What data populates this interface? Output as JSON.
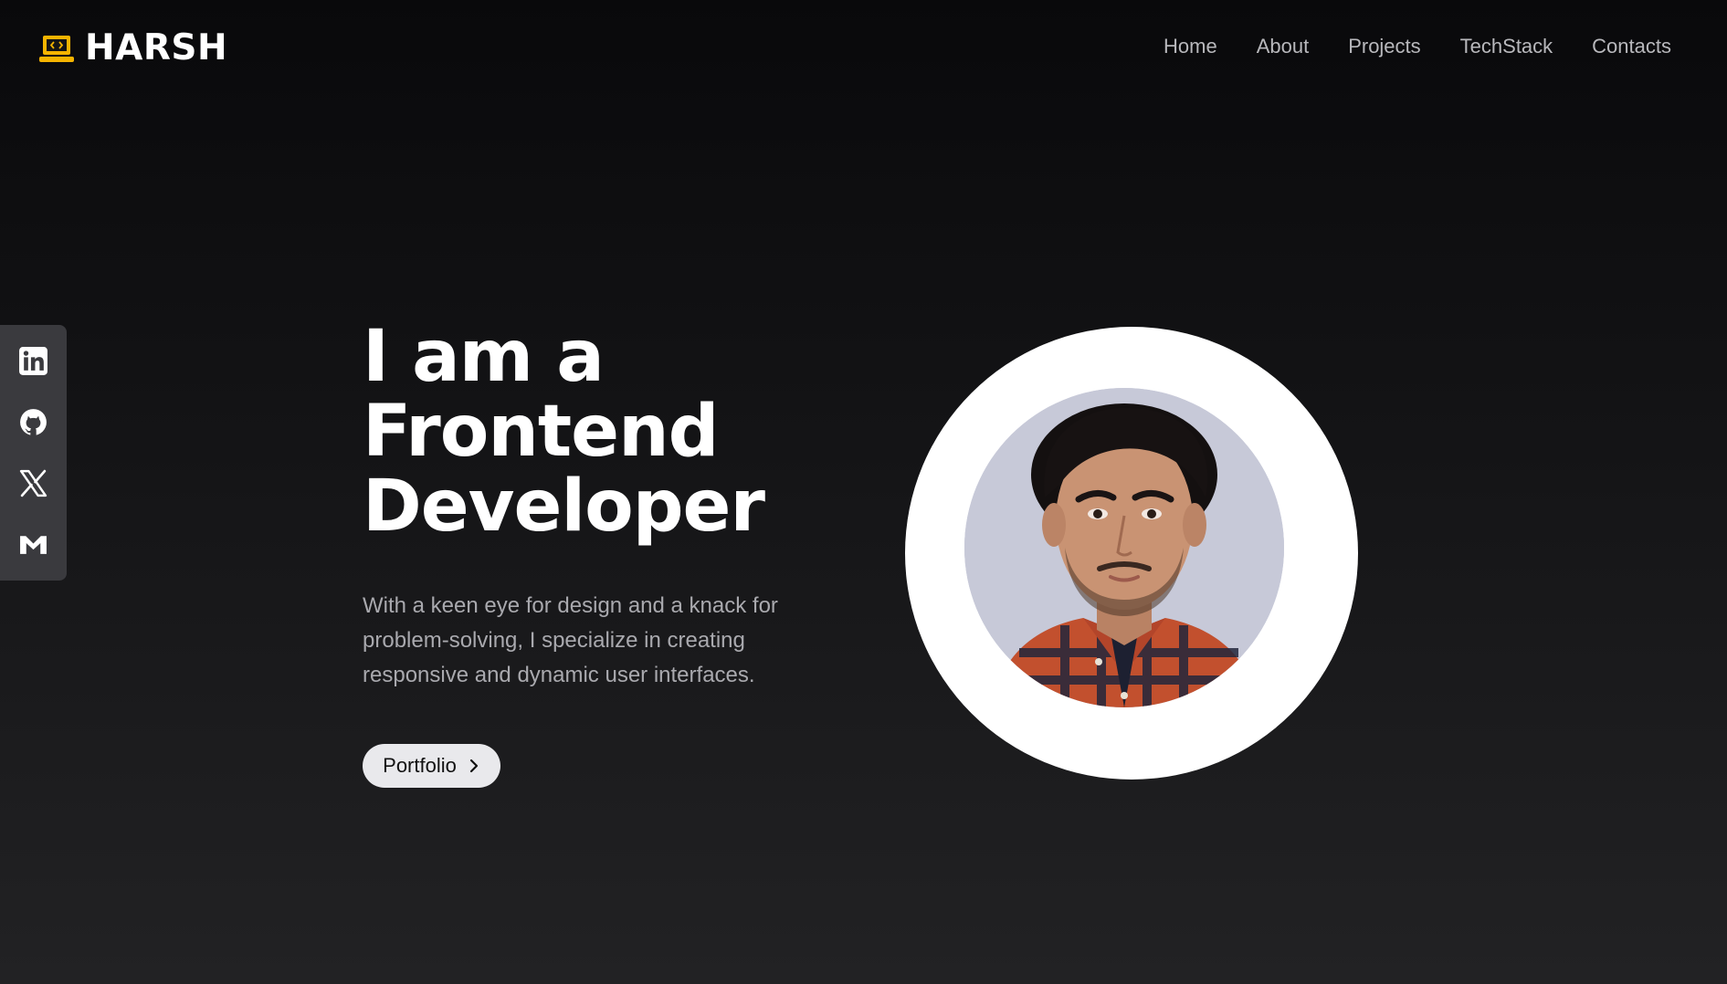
{
  "brand": {
    "name": "HARSH",
    "icon": "laptop-code-icon",
    "accent_color": "#f5b400"
  },
  "nav": {
    "items": [
      {
        "label": "Home"
      },
      {
        "label": "About"
      },
      {
        "label": "Projects"
      },
      {
        "label": "TechStack"
      },
      {
        "label": "Contacts"
      }
    ]
  },
  "social": {
    "items": [
      {
        "icon": "linkedin-icon"
      },
      {
        "icon": "github-icon"
      },
      {
        "icon": "x-twitter-icon"
      },
      {
        "icon": "gmail-icon"
      }
    ]
  },
  "hero": {
    "title_lines": [
      "I am a",
      "Frontend",
      "Developer"
    ],
    "description": "With a keen eye for design and a knack for problem-solving, I specialize in creating responsive and dynamic user interfaces.",
    "cta_label": "Portfolio",
    "cta_icon": "chevron-right-icon"
  },
  "avatar": {
    "icon": "profile-photo",
    "ring_color": "#ffffff",
    "background_color": "#c7c9d8"
  }
}
